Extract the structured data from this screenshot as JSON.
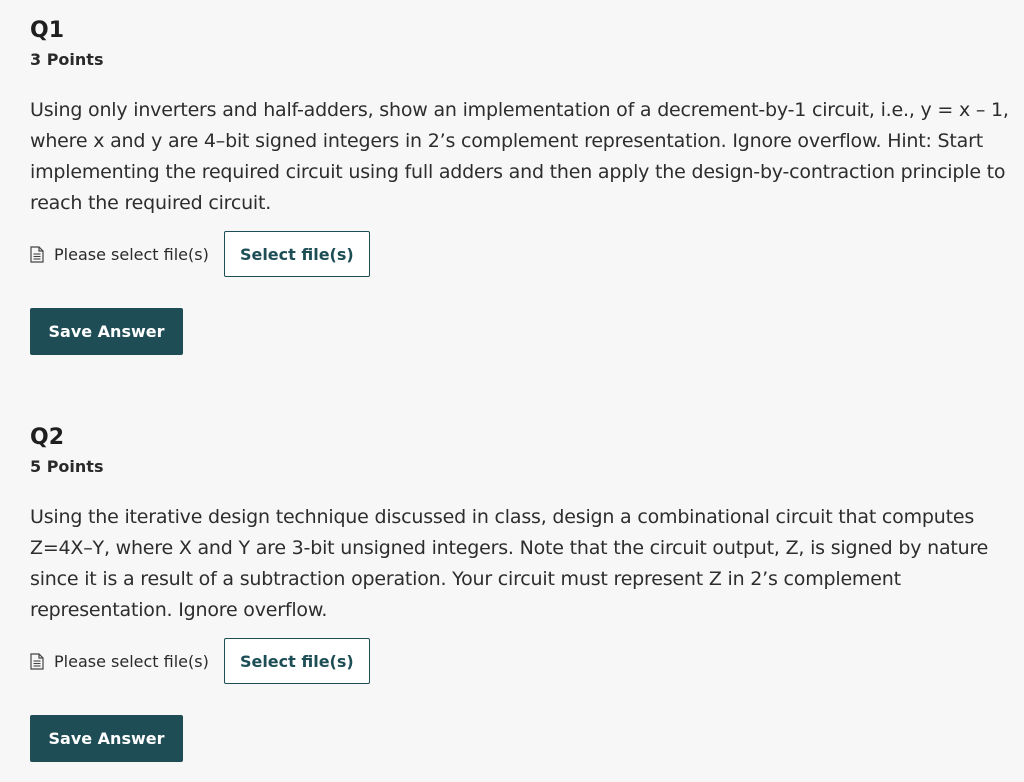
{
  "questions": [
    {
      "title": "Q1",
      "points": "3 Points",
      "body": "Using only inverters and half-adders, show an implementation of a decrement-by-1 circuit, i.e., y = x – 1, where x and y are 4–bit signed integers in 2’s complement representation. Ignore overflow. Hint: Start implementing the required circuit using full adders and then apply the design-by-contraction principle to reach the required circuit.",
      "upload_label": "Please select file(s)",
      "select_button": "Select file(s)",
      "save_button": "Save Answer",
      "file_icon": "document-icon"
    },
    {
      "title": "Q2",
      "points": "5 Points",
      "body": "Using the iterative design technique discussed in class, design a combinational circuit that computes Z=4X–Y, where X and Y are 3-bit unsigned integers. Note that the circuit output, Z, is signed by nature since it is a result of a subtraction operation. Your circuit must represent Z in 2’s complement representation. Ignore overflow.",
      "upload_label": "Please select file(s)",
      "select_button": "Select file(s)",
      "save_button": "Save Answer",
      "file_icon": "document-icon"
    }
  ],
  "colors": {
    "background": "#f7f7f7",
    "primary": "#1f4d56",
    "text": "#2d2d2d"
  }
}
